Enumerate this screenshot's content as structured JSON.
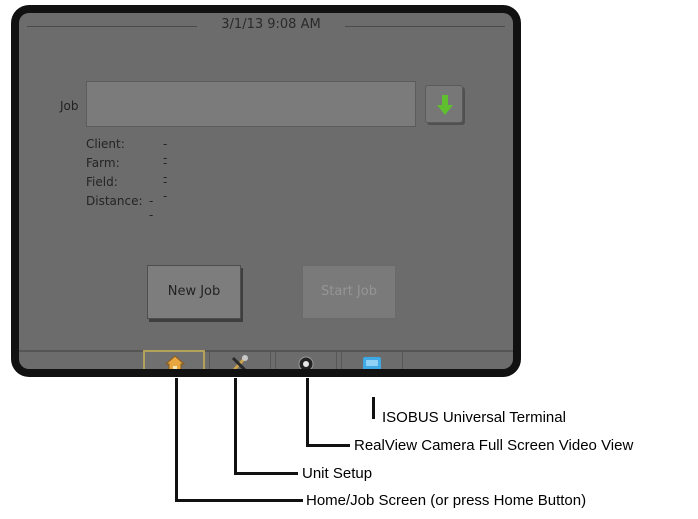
{
  "header": {
    "datetime": "3/1/13 9:08 AM"
  },
  "job": {
    "label": "Job",
    "value": ""
  },
  "info": [
    {
      "label": "Client:",
      "value": "--"
    },
    {
      "label": "Farm:",
      "value": "--"
    },
    {
      "label": "Field:",
      "value": "--"
    },
    {
      "label": "Distance:",
      "value": "--"
    }
  ],
  "buttons": {
    "new_job": "New Job",
    "start_job": "Start Job"
  },
  "taskbar": {
    "tabs": [
      {
        "icon": "home-icon",
        "selected": true
      },
      {
        "icon": "tools-icon",
        "selected": false
      },
      {
        "icon": "camera-icon",
        "selected": false
      },
      {
        "icon": "isobus-icon",
        "selected": false
      }
    ]
  },
  "callouts": [
    "ISOBUS Universal Terminal",
    "RealView Camera Full Screen Video View",
    "Unit Setup",
    "Home/Job Screen (or press Home Button)"
  ],
  "colors": {
    "accent_green": "#5fbf2f",
    "selected_tab_border": "#b2a25a"
  }
}
